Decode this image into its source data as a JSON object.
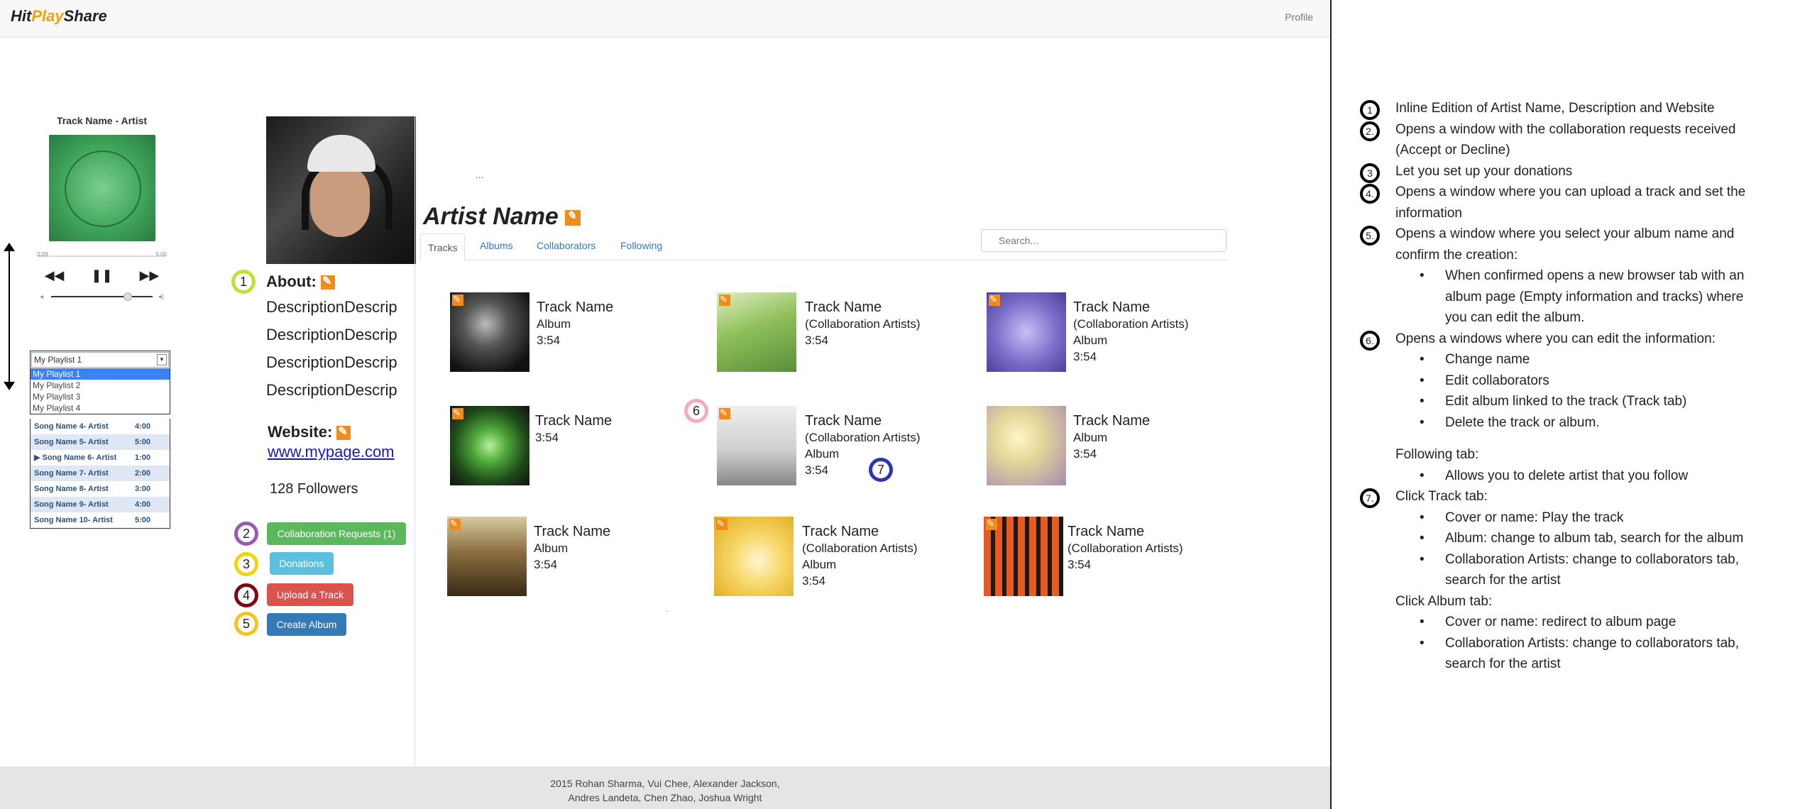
{
  "app": {
    "logo_a": "Hit",
    "logo_b": "Play",
    "logo_c": "Share",
    "profile": "Profile"
  },
  "player": {
    "track_title": "Track Name - Artist",
    "time_elapsed": "0:09",
    "time_total": "5:00",
    "rewind": "◀◀",
    "pause": "❚❚",
    "forward": "▶▶",
    "volume_level": 0.75
  },
  "playlist_select": {
    "value": "My Playlist 1",
    "options": [
      "My Playlist 1",
      "My Playlist 2",
      "My Playlist 3",
      "My Playlist 4"
    ]
  },
  "songs": [
    {
      "name": "Song Name 4- Artist",
      "duration": "4:00"
    },
    {
      "name": "Song Name 5- Artist",
      "duration": "5:00"
    },
    {
      "name": "▶ Song Name 6- Artist",
      "duration": "1:00"
    },
    {
      "name": "Song Name 7- Artist",
      "duration": "2:00"
    },
    {
      "name": "Song Name 8- Artist",
      "duration": "3:00"
    },
    {
      "name": "Song Name 9- Artist",
      "duration": "4:00"
    },
    {
      "name": "Song Name 10- Artist",
      "duration": "5:00"
    }
  ],
  "artist": {
    "about_label": "About:",
    "description_lines": [
      "DescriptionDescrip",
      "DescriptionDescrip",
      "DescriptionDescrip",
      "DescriptionDescrip"
    ],
    "website_label": "Website:",
    "website": "www.mypage.com",
    "followers": "128 Followers",
    "name": "Artist Name",
    "top_dots": "..."
  },
  "buttons": {
    "collab": "Collaboration Requests (1)",
    "donations": "Donations",
    "upload": "Upload a Track",
    "create_album": "Create Album"
  },
  "tabs": [
    "Tracks",
    "Albums",
    "Collaborators",
    "Following"
  ],
  "search": {
    "placeholder": "Search..."
  },
  "tracks": [
    {
      "lines": [
        "Track Name",
        "Album",
        "3:54"
      ],
      "cover": "#2f2f2f"
    },
    {
      "lines": [
        "Track Name",
        "(Collaboration Artists)",
        "3:54"
      ],
      "cover": "#8fbf5a"
    },
    {
      "lines": [
        "Track Name",
        "(Collaboration Artists)",
        "Album",
        "3:54"
      ],
      "cover": "#7a6ec9"
    },
    {
      "lines": [
        "Track Name",
        "3:54"
      ],
      "cover": "#2f6f2a"
    },
    {
      "lines": [
        "Track Name",
        "(Collaboration Artists)",
        "Album",
        "3:54"
      ],
      "cover": "#d8d8d8"
    },
    {
      "lines": [
        "Track Name",
        "Album",
        "3:54"
      ],
      "cover": "#c9b98a"
    },
    {
      "lines": [
        "Track Name",
        "Album",
        "3:54"
      ],
      "cover": "#6b5230"
    },
    {
      "lines": [
        "Track Name",
        "(Collaboration Artists)",
        "Album",
        "3:54"
      ],
      "cover": "#f2c230"
    },
    {
      "lines": [
        "Track Name",
        "(Collaboration Artists)",
        "3:54"
      ],
      "cover": "#d04a1a"
    }
  ],
  "callouts": [
    "1",
    "2",
    "3",
    "4",
    "5",
    "6",
    "7"
  ],
  "notes": {
    "n1": "Inline Edition of Artist Name, Description and Website",
    "n2": "Opens a window with the collaboration requests received (Accept or Decline)",
    "n3": "Let you set up your donations",
    "n4": "Opens a window where you can upload a track and set the information",
    "n5": "Opens a window where you select your album name and confirm the creation:",
    "n5_b1": "When confirmed opens a new browser tab with an album page (Empty information and tracks) where you can edit the album.",
    "n6": "Opens a windows where you can edit the information:",
    "n6_b1": "Change name",
    "n6_b2": "Edit collaborators",
    "n6_b3": "Edit album linked to the track (Track tab)",
    "n6_b4": "Delete the track or album.",
    "following_tab": "Following tab:",
    "following_b1": "Allows you to delete artist that you follow",
    "n7": "Click Track tab:",
    "n7_b1": "Cover or name: Play the track",
    "n7_b2": "Album: change to album tab, search for the album",
    "n7_b3": "Collaboration Artists: change to collaborators tab, search for the artist",
    "album_tab": "Click Album tab:",
    "album_b1": "Cover or name: redirect to album page",
    "album_b2": "Collaboration Artists: change to collaborators tab, search for the artist",
    "labels": {
      "l1": "1",
      "l2": "2.",
      "l3": "3",
      "l4": "4.",
      "l5": "5.",
      "l6": "6.",
      "l7": "7."
    }
  },
  "footer": {
    "line1": "2015 Rohan Sharma, Vui Chee, Alexander Jackson,",
    "line2": "Andres Landeta, Chen Zhao, Joshua Wright"
  },
  "colors": {
    "edit": "#f08c1a",
    "link": "#337ab7",
    "green": "#5cb85c",
    "cyan": "#5bc0de",
    "red": "#d9534f",
    "blue": "#337ab7"
  }
}
